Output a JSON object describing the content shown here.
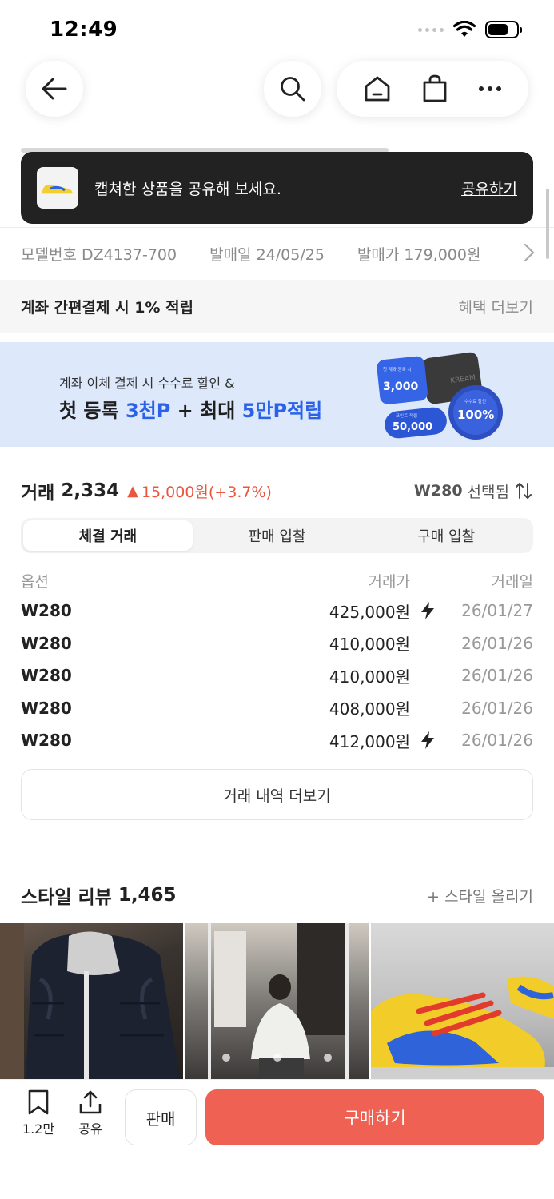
{
  "status": {
    "time": "12:49"
  },
  "toast": {
    "message": "캡쳐한 상품을 공유해 보세요.",
    "action": "공유하기"
  },
  "meta": {
    "model": "모델번호 DZ4137-700",
    "release_date": "발매일 24/05/25",
    "release_price": "발매가 179,000원"
  },
  "benefit": {
    "title": "계좌 간편결제 시 1% 적립",
    "more": "혜택 더보기"
  },
  "banner": {
    "sub": "계좌 이체 결제 시 수수료 할인 &",
    "main_a": "첫 등록 ",
    "main_hl1": "3천P",
    "main_b": " + 최대 ",
    "main_hl2": "5만P적립",
    "coin1": "3,000",
    "coin2": "50,000",
    "coin3": "100%",
    "coin1_small": "첫 계좌 등록 시",
    "coin2_small": "포인트 적립",
    "coin3_small": "수수료 할인"
  },
  "trade": {
    "label": "거래",
    "count": "2,334",
    "up_symbol": "▲",
    "delta": "15,000원(+3.7%)",
    "size": "W280",
    "size_suffix": "선택됨",
    "tabs": [
      "체결 거래",
      "판매 입찰",
      "구매 입찰"
    ],
    "columns": [
      "옵션",
      "거래가",
      "거래일"
    ],
    "rows": [
      {
        "option": "W280",
        "price": "425,000원",
        "date": "26/01/27",
        "fast": true
      },
      {
        "option": "W280",
        "price": "410,000원",
        "date": "26/01/26",
        "fast": false
      },
      {
        "option": "W280",
        "price": "410,000원",
        "date": "26/01/26",
        "fast": false
      },
      {
        "option": "W280",
        "price": "408,000원",
        "date": "26/01/26",
        "fast": false
      },
      {
        "option": "W280",
        "price": "412,000원",
        "date": "26/01/26",
        "fast": true
      }
    ],
    "more": "거래 내역 더보기"
  },
  "style": {
    "title": "스타일 리뷰",
    "count": "1,465",
    "upload": "+ 스타일 올리기"
  },
  "bottom": {
    "bookmark_count": "1.2만",
    "share_label": "공유",
    "sell_label": "판매",
    "buy_label": "구매하기"
  },
  "colors": {
    "accent": "#ef6253",
    "delta": "#e9553d",
    "banner_bg": "#dde8fb",
    "highlight": "#2a63e8"
  }
}
